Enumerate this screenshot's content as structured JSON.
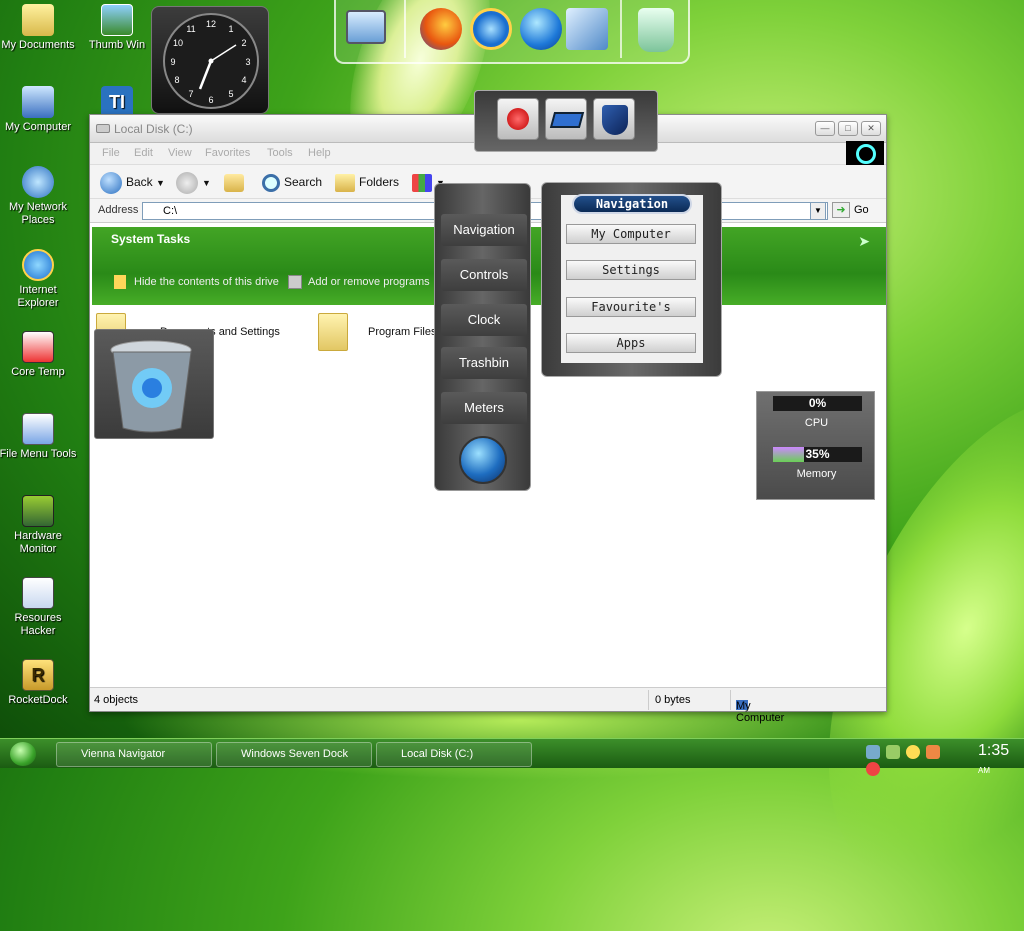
{
  "desktop": {
    "icons": [
      {
        "label": "My Documents"
      },
      {
        "label": "Thumb Win"
      },
      {
        "label": "My Computer"
      },
      {
        "label": "My Network Places"
      },
      {
        "label": "Internet Explorer"
      },
      {
        "label": "Core Temp"
      },
      {
        "label": "File Menu Tools"
      },
      {
        "label": "Hardware Monitor"
      },
      {
        "label": "Resoures Hacker"
      },
      {
        "label": "RocketDock"
      }
    ]
  },
  "clock_widget": {
    "numerals": [
      "12",
      "1",
      "2",
      "3",
      "4",
      "5",
      "6",
      "7",
      "8",
      "9",
      "10",
      "11"
    ]
  },
  "dock": {
    "items": [
      {
        "icon": "monitor-icon"
      },
      {
        "icon": "firefox-icon"
      },
      {
        "icon": "internet-explorer-icon"
      },
      {
        "icon": "media-player-icon"
      },
      {
        "icon": "control-panel-icon"
      },
      {
        "icon": "recycle-bin-icon"
      }
    ]
  },
  "explorer": {
    "title": "Local Disk (C:)",
    "menu": [
      "File",
      "Edit",
      "View",
      "Favorites",
      "Tools",
      "Help"
    ],
    "toolbar": {
      "back": "Back",
      "search": "Search",
      "folders": "Folders"
    },
    "address": {
      "label": "Address",
      "value": "C:\\",
      "go": "Go"
    },
    "tasks": {
      "heading": "System Tasks",
      "hide_link": "Hide the contents of this drive",
      "add_link": "Add or remove programs"
    },
    "files": [
      {
        "name": "Documents and Settings"
      },
      {
        "name": "Program Files"
      }
    ],
    "status": {
      "objects": "4 objects",
      "size": "0 bytes",
      "location": "My Computer"
    }
  },
  "control_panel": {
    "items": [
      "Navigation",
      "Controls",
      "Clock",
      "Trashbin",
      "Meters"
    ]
  },
  "navigation_menu": {
    "title": "Navigation",
    "items": [
      "My Computer",
      "Settings",
      "Favourite's",
      "Apps"
    ]
  },
  "meters": {
    "cpu": {
      "value": "0%",
      "label": "CPU",
      "percent": 0
    },
    "memory": {
      "value": "35%",
      "label": "Memory",
      "percent": 35
    }
  },
  "taskbar": {
    "tasks": [
      "Vienna Navigator",
      "Windows Seven Dock",
      "Local Disk (C:)"
    ],
    "clock": {
      "time": "1:35",
      "ampm": "AM"
    }
  },
  "colors": {
    "accent_green": "#3ea31a",
    "window_bg": "#ffffff",
    "nav_header": "#0b2a55"
  }
}
